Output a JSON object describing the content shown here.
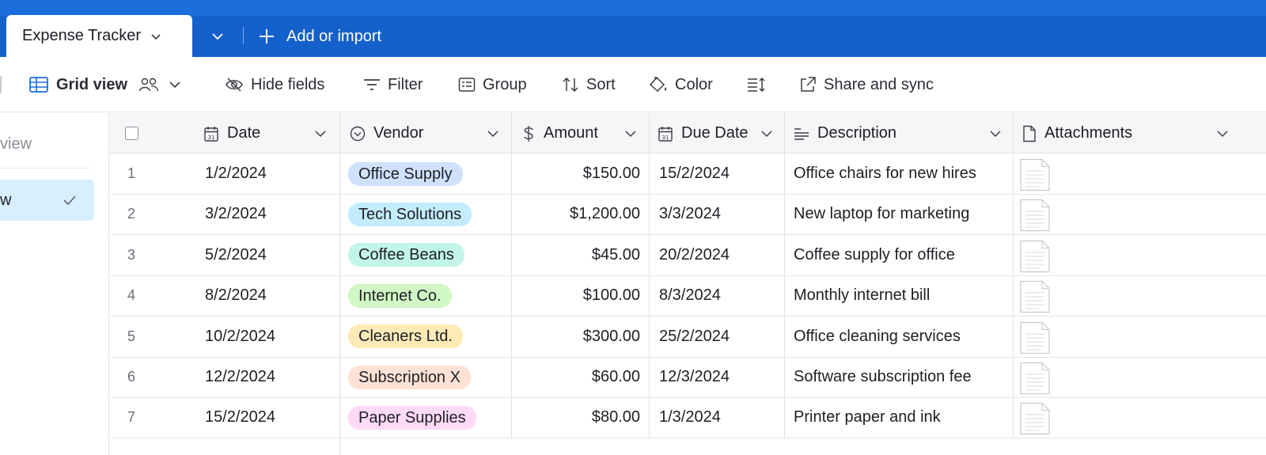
{
  "tabs": {
    "active_label": "Expense Tracker",
    "add_label": "Add or import"
  },
  "toolbar": {
    "view_label": "Grid view",
    "hide_fields": "Hide fields",
    "filter": "Filter",
    "group": "Group",
    "sort": "Sort",
    "color": "Color",
    "share": "Share and sync"
  },
  "sidebar": {
    "search_fragment": "view",
    "active_fragment": "w"
  },
  "columns": {
    "date": "Date",
    "vendor": "Vendor",
    "amount": "Amount",
    "due_date": "Due Date",
    "description": "Description",
    "attachments": "Attachments"
  },
  "rows": [
    {
      "num": "1",
      "date": "1/2/2024",
      "vendor": "Office Supply",
      "amount": "$150.00",
      "due": "15/2/2024",
      "desc": "Office chairs for new hires"
    },
    {
      "num": "2",
      "date": "3/2/2024",
      "vendor": "Tech Solutions",
      "amount": "$1,200.00",
      "due": "3/3/2024",
      "desc": "New laptop for marketing"
    },
    {
      "num": "3",
      "date": "5/2/2024",
      "vendor": "Coffee Beans",
      "amount": "$45.00",
      "due": "20/2/2024",
      "desc": "Coffee supply for office"
    },
    {
      "num": "4",
      "date": "8/2/2024",
      "vendor": "Internet Co.",
      "amount": "$100.00",
      "due": "8/3/2024",
      "desc": "Monthly internet bill"
    },
    {
      "num": "5",
      "date": "10/2/2024",
      "vendor": "Cleaners Ltd.",
      "amount": "$300.00",
      "due": "25/2/2024",
      "desc": "Office cleaning services"
    },
    {
      "num": "6",
      "date": "12/2/2024",
      "vendor": "Subscription X",
      "amount": "$60.00",
      "due": "12/3/2024",
      "desc": "Software subscription fee"
    },
    {
      "num": "7",
      "date": "15/2/2024",
      "vendor": "Paper Supplies",
      "amount": "$80.00",
      "due": "1/3/2024",
      "desc": "Printer paper and ink"
    }
  ],
  "vendor_colors": {
    "Office Supply": "#d0e1fd",
    "Tech Solutions": "#c4ecff",
    "Coffee Beans": "#c2f5e9",
    "Internet Co.": "#d1f7c4",
    "Cleaners Ltd.": "#ffeab6",
    "Subscription X": "#fee2d5",
    "Paper Supplies": "#ffdaf6"
  },
  "colors": {
    "topbar": "#1461cc",
    "accent": "#1a6fdc"
  }
}
